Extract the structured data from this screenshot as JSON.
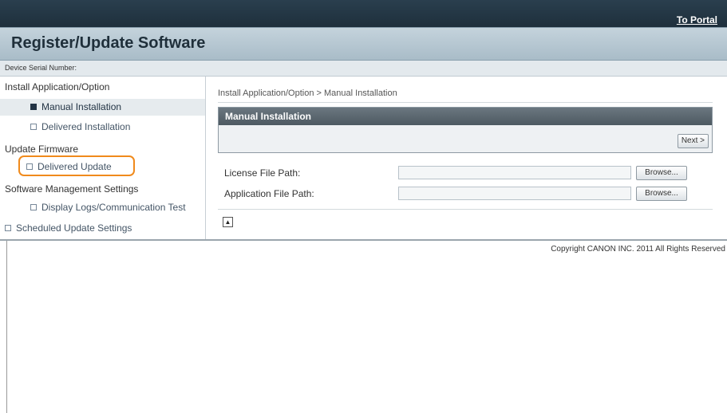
{
  "header": {
    "portal_link": "To Portal",
    "title": "Register/Update Software"
  },
  "device": {
    "serial_label": "Device Serial Number:"
  },
  "sidebar": {
    "group_install": "Install Application/Option",
    "item_manual": "Manual Installation",
    "item_delivered_install": "Delivered Installation",
    "group_firmware": "Update Firmware",
    "item_delivered_update": "Delivered Update",
    "group_mgmt": "Software Management Settings",
    "item_logs": "Display Logs/Communication Test",
    "item_scheduled": "Scheduled Update Settings"
  },
  "main": {
    "breadcrumb": "Install Application/Option > Manual Installation",
    "panel_title": "Manual Installation",
    "next_label": "Next >",
    "license_label": "License File Path:",
    "application_label": "Application File Path:",
    "license_value": "",
    "application_value": "",
    "browse_label": "Browse..."
  },
  "footer": {
    "copyright": "Copyright CANON INC. 2011 All Rights Reserved"
  },
  "colors": {
    "highlight": "#f08a1c",
    "header_bg": "#2a3f4e",
    "panel_header": "#4d5961"
  }
}
